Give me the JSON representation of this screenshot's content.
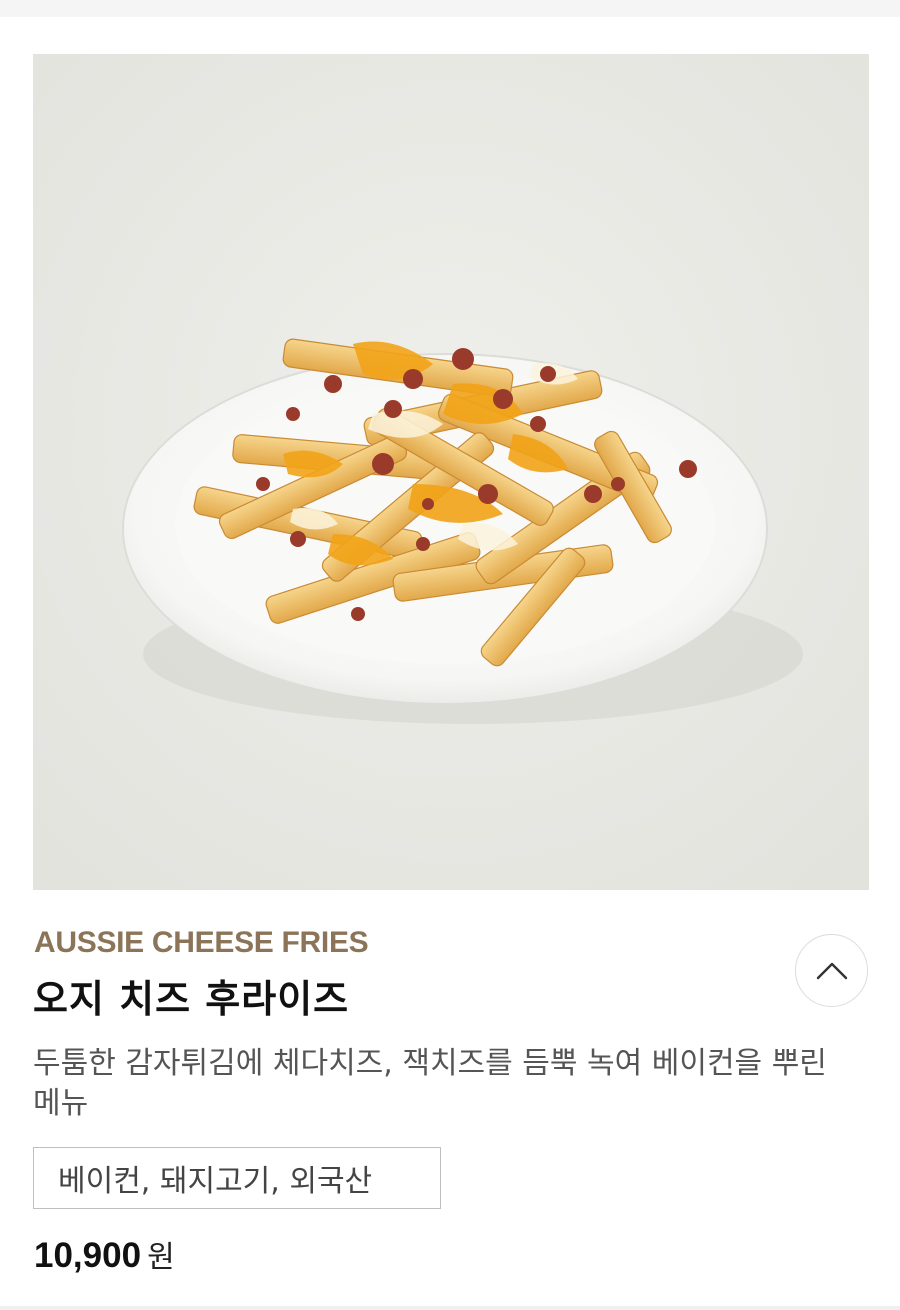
{
  "product": {
    "name_en": "AUSSIE CHEESE FRIES",
    "name_ko": "오지 치즈 후라이즈",
    "description": "두툼한 감자튀김에 체다치즈, 잭치즈를 듬뿍 녹여 베이컨을 뿌린 메뉴",
    "origin": "베이컨, 돼지고기, 외국산",
    "price": "10,900",
    "price_unit": "원"
  },
  "colors": {
    "name_en": "#8b7457",
    "photo_background": "#e9e9e5"
  },
  "icons": {
    "collapse": "chevron-up-icon"
  }
}
